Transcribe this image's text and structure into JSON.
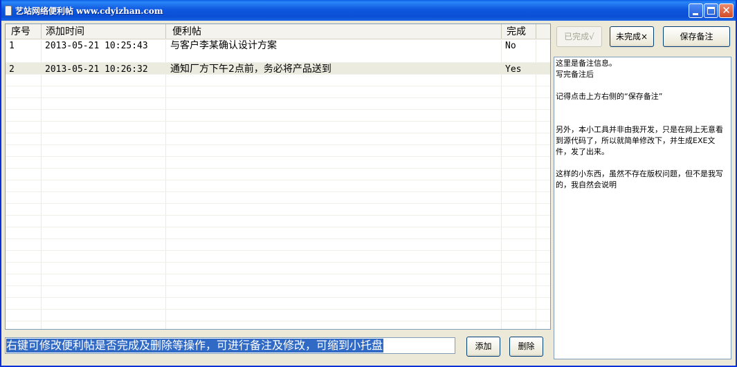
{
  "window": {
    "title": "艺站网络便利帖 www.cdyizhan.com"
  },
  "grid": {
    "columns": [
      "序号",
      "添加时间",
      "便利帖",
      "完成"
    ],
    "rows": [
      {
        "id": "1",
        "time": "2013-05-21 10:25:43",
        "note": "与客户李某确认设计方案",
        "done": "No"
      },
      {
        "id": "2",
        "time": "2013-05-21 10:26:32",
        "note": "通知厂方下午2点前，务必将产品送到",
        "done": "Yes"
      }
    ]
  },
  "toolbar": {
    "complete_label": "已完成√",
    "incomplete_label": "未完成×",
    "save_label": "保存备注"
  },
  "notes": {
    "text": "这里是备注信息。\n写完备注后\n\n记得点击上方右侧的“保存备注”\n\n\n另外，本小工具并非由我开发，只是在网上无意看到源代码了，所以就简单修改下，并生成EXE文件，发了出来。\n\n这样的小东西，虽然不存在版权问题，但不是我写的，我自然会说明"
  },
  "input": {
    "value": "右键可修改便利帖是否完成及删除等操作，可进行备注及修改，可缩到小托盘"
  },
  "actions": {
    "add_label": "添加",
    "delete_label": "删除"
  }
}
